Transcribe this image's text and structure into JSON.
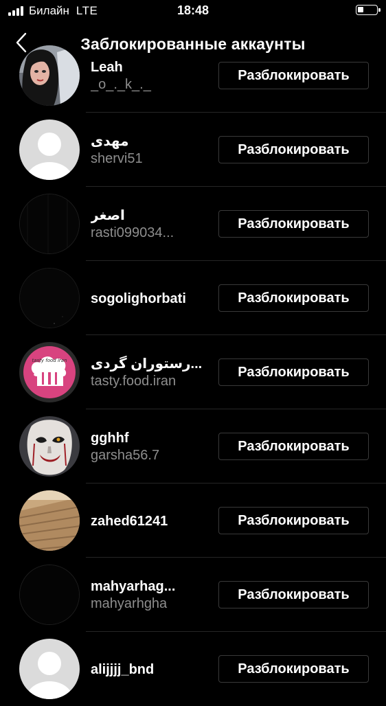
{
  "status_bar": {
    "carrier": "Билайн",
    "network": "LTE",
    "time": "18:48"
  },
  "nav": {
    "title": "Заблокированные аккаунты",
    "back_icon": "chevron-left-icon"
  },
  "blocked_accounts": [
    {
      "username": "Leah",
      "fullname": "_o_._k_._",
      "avatar": "photo-woman-dark-hair"
    },
    {
      "username": "مهدی",
      "fullname": "shervi51",
      "avatar": "default-avatar-placeholder"
    },
    {
      "username": "اصغر",
      "fullname": "rasti099034...",
      "avatar": "dark-photo"
    },
    {
      "username": "sogolighorbati",
      "fullname": "",
      "avatar": "dark-photo"
    },
    {
      "username": "رستوران گردی...",
      "fullname": "tasty.food.iran",
      "avatar": "pink-chef-hat-logo"
    },
    {
      "username": "gghhf",
      "fullname": "garsha56.7",
      "avatar": "photo-clown-face"
    },
    {
      "username": "zahed61241",
      "fullname": "",
      "avatar": "photo-wooden-boardwalk"
    },
    {
      "username": "mahyarhag...",
      "fullname": "mahyarhgha",
      "avatar": "dark-photo"
    },
    {
      "username": "alijjjj_bnd",
      "fullname": "",
      "avatar": "default-avatar-placeholder"
    }
  ],
  "unblock_label": "Разблокировать",
  "logo_text": "tasty food iran",
  "colors": {
    "background": "#000000",
    "divider": "#262626",
    "secondary_text": "#8e8e8e",
    "button_border": "#3a3a3a",
    "logo_pink": "#d8437f"
  }
}
